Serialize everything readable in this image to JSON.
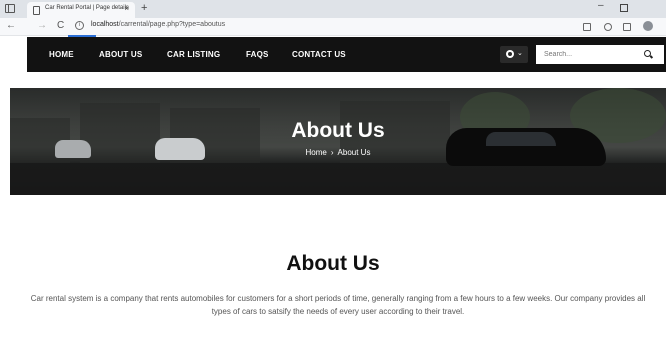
{
  "browser": {
    "tab_title": "Car Rental Portal | Page details",
    "tab_close": "×",
    "new_tab": "+",
    "url_host": "localhost",
    "url_path": "/carrental/page.php?type=aboutus",
    "back": "←",
    "forward": "→",
    "reload": "C",
    "info": "i",
    "window_minimize": "–"
  },
  "navbar": {
    "links": [
      "HOME",
      "ABOUT US",
      "CAR LISTING",
      "FAQS",
      "CONTACT US"
    ],
    "user_caret": "⌄",
    "search_placeholder": "Search..."
  },
  "banner": {
    "title": "About Us",
    "breadcrumb": [
      "Home",
      "About Us"
    ],
    "separator": "›"
  },
  "main": {
    "title": "About Us",
    "text": "Car rental system is a company that rents automobiles for customers for a short periods of time, generally ranging from a few hours to a few weeks. Our company provides all types of cars to satsify the needs of every user according to their travel."
  },
  "colors": {
    "navbar_bg": "#121212",
    "accent_underline": "#2b6fd6"
  }
}
